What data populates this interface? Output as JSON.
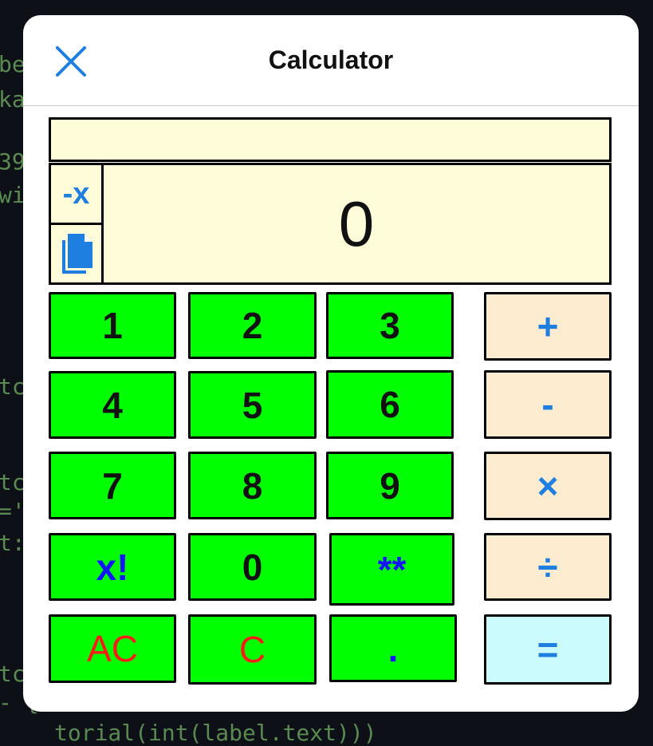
{
  "background_code": [
    "be",
    "kab",
    "39",
    "wit",
    "tch",
    "tch",
    "='",
    "t:",
    "tch",
    "- {",
    "torial(int(label.text)))"
  ],
  "dialog": {
    "title": "Calculator",
    "close_icon": "close-icon",
    "expression": "",
    "display_value": "0",
    "negate_label": "-x",
    "copy_icon": "copy-icon"
  },
  "keys": {
    "k1": "1",
    "k2": "2",
    "k3": "3",
    "plus": "+",
    "k4": "4",
    "k5": "5",
    "k6": "6",
    "minus": "-",
    "k7": "7",
    "k8": "8",
    "k9": "9",
    "multiply": "×",
    "factorial": "x!",
    "k0": "0",
    "power": "**",
    "divide": "÷",
    "ac": "AC",
    "clear": "C",
    "decimal": ".",
    "equals": "="
  },
  "colors": {
    "number_key": "#00ff00",
    "operator_key": "#fdeccf",
    "equals_key": "#ccfbfd",
    "display_bg": "#fefcd9",
    "accent_blue": "#1f7fe0",
    "clear_red": "#ff1a1a"
  }
}
